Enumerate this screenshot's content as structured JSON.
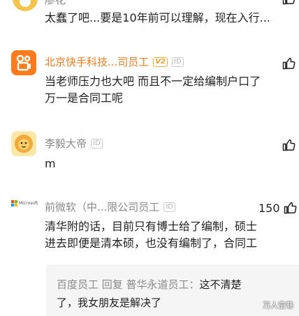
{
  "comments": [
    {
      "user": "廖花",
      "text": "太蠢了吧...要是10年前可以理解，现在入行..."
    },
    {
      "user": "北京快手科技...司员工",
      "text_line1": "当老师压力也大吧 而且不一定给编制户口了",
      "text_line2": "万一是合同工呢"
    },
    {
      "user": "李毅大帝",
      "text": "m"
    },
    {
      "user": "前微软（中...限公司员工",
      "likes": "150",
      "avatar_text": "Microsoft",
      "text_line1": "清华附的话，目前只有博士给了编制，硕士",
      "text_line2": "进去即便是清本硕，也没有编制了，合同工",
      "reply": {
        "meta": "百度员工 回复 普华永道员工：",
        "text_line1_tail": "这不清楚",
        "text_line2": "了，我女朋友是解决了"
      }
    }
  ],
  "badges": {
    "id": "ID",
    "v": "V2"
  },
  "watermark": "万人空巷",
  "colors": {
    "accent_orange": "#f07c1f",
    "gray_text": "#8a8a8a",
    "reply_bg": "#f5f5f5"
  }
}
